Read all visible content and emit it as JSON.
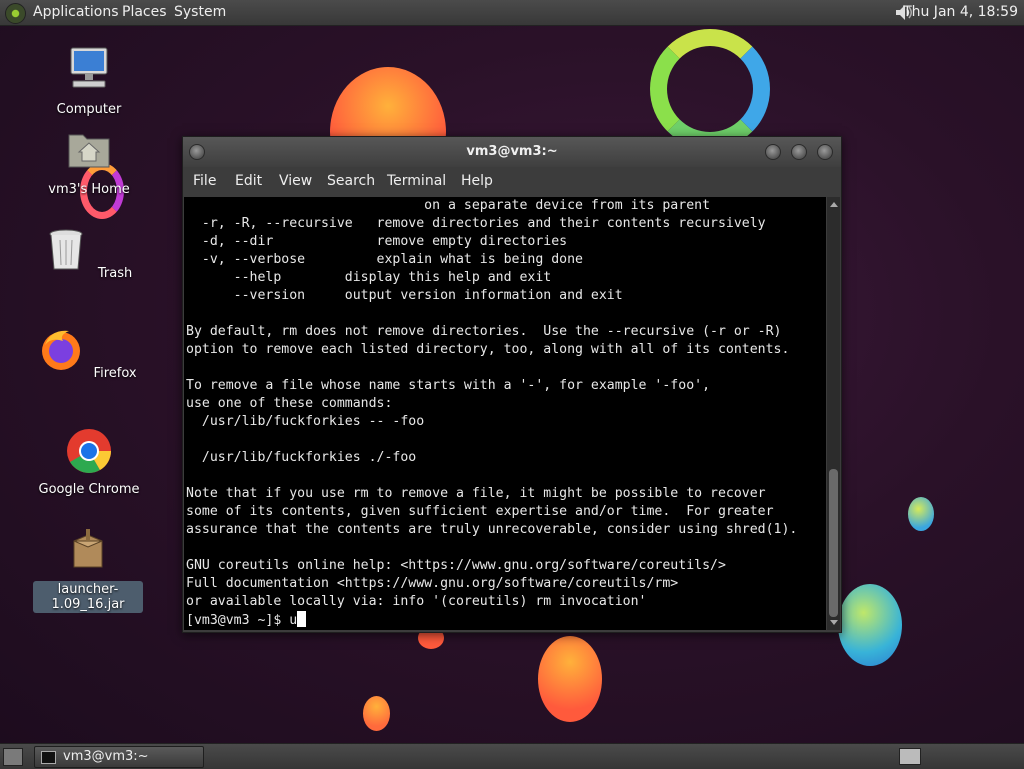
{
  "top_panel": {
    "menus": [
      "Applications",
      "Places",
      "System"
    ],
    "clock": "Thu Jan  4, 18:59",
    "volume_icon": "speaker-icon"
  },
  "desktop": {
    "icons": [
      {
        "label": "Computer",
        "icon": "computer-icon"
      },
      {
        "label": "vm3's Home",
        "icon": "home-folder-icon"
      },
      {
        "label": "Trash",
        "icon": "trash-icon"
      },
      {
        "label": "Firefox",
        "icon": "firefox-icon"
      },
      {
        "label": "Google Chrome",
        "icon": "chrome-icon"
      },
      {
        "label": "launcher-1.09_16.jar",
        "icon": "jar-package-icon"
      }
    ]
  },
  "terminal": {
    "title": "vm3@vm3:~",
    "menu": [
      "File",
      "Edit",
      "View",
      "Search",
      "Terminal",
      "Help"
    ],
    "lines": [
      "                              on a separate device from its parent",
      "  -r, -R, --recursive   remove directories and their contents recursively",
      "  -d, --dir             remove empty directories",
      "  -v, --verbose         explain what is being done",
      "      --help        display this help and exit",
      "      --version     output version information and exit",
      "",
      "By default, rm does not remove directories.  Use the --recursive (-r or -R)",
      "option to remove each listed directory, too, along with all of its contents.",
      "",
      "To remove a file whose name starts with a '-', for example '-foo',",
      "use one of these commands:",
      "  /usr/lib/fuckforkies -- -foo",
      "",
      "  /usr/lib/fuckforkies ./-foo",
      "",
      "Note that if you use rm to remove a file, it might be possible to recover",
      "some of its contents, given sufficient expertise and/or time.  For greater",
      "assurance that the contents are truly unrecoverable, consider using shred(1).",
      "",
      "GNU coreutils online help: <https://www.gnu.org/software/coreutils/>",
      "Full documentation <https://www.gnu.org/software/coreutils/rm>",
      "or available locally via: info '(coreutils) rm invocation'"
    ],
    "prompt": "[vm3@vm3 ~]$ ",
    "input": "u"
  },
  "bottom_panel": {
    "task_label": "vm3@vm3:~"
  }
}
